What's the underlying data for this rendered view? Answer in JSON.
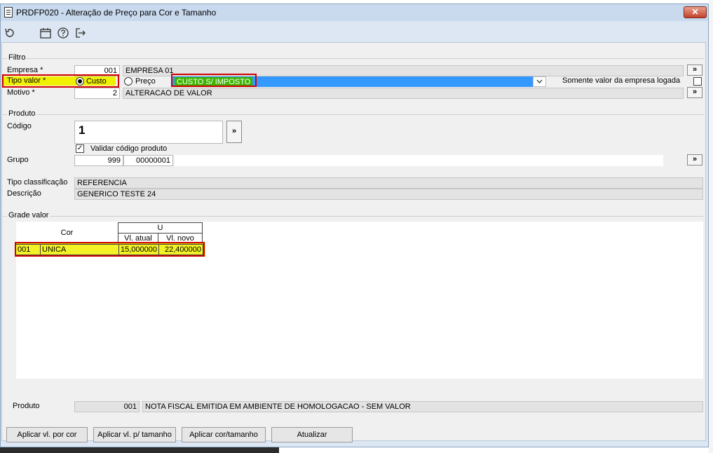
{
  "window": {
    "title": "PRDFP020 - Alteração de Preço para Cor e Tamanho",
    "close_glyph": "✕"
  },
  "toolbar": {
    "icons": [
      "undo-icon",
      "calendar-icon",
      "help-icon",
      "exit-icon"
    ]
  },
  "filtro": {
    "title": "Filtro",
    "empresa_label": "Empresa *",
    "empresa_code": "001",
    "empresa_name": "EMPRESA 01",
    "tipo_valor_label": "Tipo valor *",
    "custo_label": "Custo",
    "preco_label": "Preço",
    "tipo_select_value": "CUSTO S/ IMPOSTO",
    "somente_label": "Somente valor da empresa logada",
    "motivo_label": "Motivo *",
    "motivo_code": "2",
    "motivo_name": "ALTERACAO DE VALOR",
    "lookup_glyph": "»"
  },
  "produto": {
    "title": "Produto",
    "codigo_label": "Código",
    "codigo_value": "1",
    "validar_label": "Validar código produto",
    "grupo_label": "Grupo",
    "grupo_code": "999",
    "grupo_num": "00000001",
    "tipo_class_label": "Tipo classificação",
    "tipo_class_value": "REFERENCIA",
    "descricao_label": "Descrição",
    "descricao_value": "GENERICO TESTE 24"
  },
  "grade": {
    "title": "Grade valor",
    "col_cor": "Cor",
    "col_size": "U",
    "col_atual": "Vl. atual",
    "col_novo": "Vl. novo",
    "rows": [
      {
        "code": "001",
        "name": "UNICA",
        "atual": "15,000000",
        "novo": "22,400000"
      }
    ]
  },
  "footer": {
    "produto_label": "Produto",
    "produto_code": "001",
    "produto_desc": "NOTA FISCAL EMITIDA EM AMBIENTE DE HOMOLOGACAO - SEM VALOR"
  },
  "buttons": {
    "aplicar_cor": "Aplicar vl. por cor",
    "aplicar_tamanho": "Aplicar vl. p/ tamanho",
    "aplicar_cor_tamanho": "Aplicar cor/tamanho",
    "atualizar": "Atualizar"
  },
  "colors": {
    "highlight_yellow": "#f0f000",
    "select_blue": "#3399ff",
    "select_green": "#3cb400",
    "red_annotation": "#d40000"
  }
}
